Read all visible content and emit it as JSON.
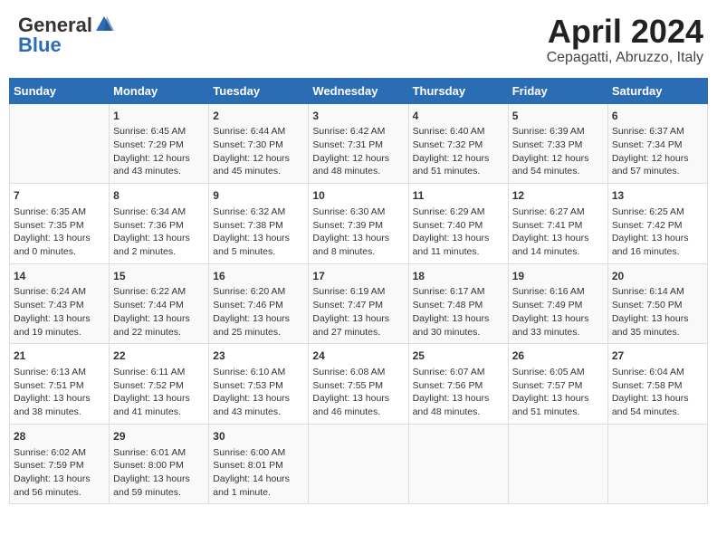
{
  "header": {
    "logo_general": "General",
    "logo_blue": "Blue",
    "title": "April 2024",
    "subtitle": "Cepagatti, Abruzzo, Italy"
  },
  "days_of_week": [
    "Sunday",
    "Monday",
    "Tuesday",
    "Wednesday",
    "Thursday",
    "Friday",
    "Saturday"
  ],
  "weeks": [
    [
      {
        "day": "",
        "content": ""
      },
      {
        "day": "1",
        "content": "Sunrise: 6:45 AM\nSunset: 7:29 PM\nDaylight: 12 hours\nand 43 minutes."
      },
      {
        "day": "2",
        "content": "Sunrise: 6:44 AM\nSunset: 7:30 PM\nDaylight: 12 hours\nand 45 minutes."
      },
      {
        "day": "3",
        "content": "Sunrise: 6:42 AM\nSunset: 7:31 PM\nDaylight: 12 hours\nand 48 minutes."
      },
      {
        "day": "4",
        "content": "Sunrise: 6:40 AM\nSunset: 7:32 PM\nDaylight: 12 hours\nand 51 minutes."
      },
      {
        "day": "5",
        "content": "Sunrise: 6:39 AM\nSunset: 7:33 PM\nDaylight: 12 hours\nand 54 minutes."
      },
      {
        "day": "6",
        "content": "Sunrise: 6:37 AM\nSunset: 7:34 PM\nDaylight: 12 hours\nand 57 minutes."
      }
    ],
    [
      {
        "day": "7",
        "content": "Sunrise: 6:35 AM\nSunset: 7:35 PM\nDaylight: 13 hours\nand 0 minutes."
      },
      {
        "day": "8",
        "content": "Sunrise: 6:34 AM\nSunset: 7:36 PM\nDaylight: 13 hours\nand 2 minutes."
      },
      {
        "day": "9",
        "content": "Sunrise: 6:32 AM\nSunset: 7:38 PM\nDaylight: 13 hours\nand 5 minutes."
      },
      {
        "day": "10",
        "content": "Sunrise: 6:30 AM\nSunset: 7:39 PM\nDaylight: 13 hours\nand 8 minutes."
      },
      {
        "day": "11",
        "content": "Sunrise: 6:29 AM\nSunset: 7:40 PM\nDaylight: 13 hours\nand 11 minutes."
      },
      {
        "day": "12",
        "content": "Sunrise: 6:27 AM\nSunset: 7:41 PM\nDaylight: 13 hours\nand 14 minutes."
      },
      {
        "day": "13",
        "content": "Sunrise: 6:25 AM\nSunset: 7:42 PM\nDaylight: 13 hours\nand 16 minutes."
      }
    ],
    [
      {
        "day": "14",
        "content": "Sunrise: 6:24 AM\nSunset: 7:43 PM\nDaylight: 13 hours\nand 19 minutes."
      },
      {
        "day": "15",
        "content": "Sunrise: 6:22 AM\nSunset: 7:44 PM\nDaylight: 13 hours\nand 22 minutes."
      },
      {
        "day": "16",
        "content": "Sunrise: 6:20 AM\nSunset: 7:46 PM\nDaylight: 13 hours\nand 25 minutes."
      },
      {
        "day": "17",
        "content": "Sunrise: 6:19 AM\nSunset: 7:47 PM\nDaylight: 13 hours\nand 27 minutes."
      },
      {
        "day": "18",
        "content": "Sunrise: 6:17 AM\nSunset: 7:48 PM\nDaylight: 13 hours\nand 30 minutes."
      },
      {
        "day": "19",
        "content": "Sunrise: 6:16 AM\nSunset: 7:49 PM\nDaylight: 13 hours\nand 33 minutes."
      },
      {
        "day": "20",
        "content": "Sunrise: 6:14 AM\nSunset: 7:50 PM\nDaylight: 13 hours\nand 35 minutes."
      }
    ],
    [
      {
        "day": "21",
        "content": "Sunrise: 6:13 AM\nSunset: 7:51 PM\nDaylight: 13 hours\nand 38 minutes."
      },
      {
        "day": "22",
        "content": "Sunrise: 6:11 AM\nSunset: 7:52 PM\nDaylight: 13 hours\nand 41 minutes."
      },
      {
        "day": "23",
        "content": "Sunrise: 6:10 AM\nSunset: 7:53 PM\nDaylight: 13 hours\nand 43 minutes."
      },
      {
        "day": "24",
        "content": "Sunrise: 6:08 AM\nSunset: 7:55 PM\nDaylight: 13 hours\nand 46 minutes."
      },
      {
        "day": "25",
        "content": "Sunrise: 6:07 AM\nSunset: 7:56 PM\nDaylight: 13 hours\nand 48 minutes."
      },
      {
        "day": "26",
        "content": "Sunrise: 6:05 AM\nSunset: 7:57 PM\nDaylight: 13 hours\nand 51 minutes."
      },
      {
        "day": "27",
        "content": "Sunrise: 6:04 AM\nSunset: 7:58 PM\nDaylight: 13 hours\nand 54 minutes."
      }
    ],
    [
      {
        "day": "28",
        "content": "Sunrise: 6:02 AM\nSunset: 7:59 PM\nDaylight: 13 hours\nand 56 minutes."
      },
      {
        "day": "29",
        "content": "Sunrise: 6:01 AM\nSunset: 8:00 PM\nDaylight: 13 hours\nand 59 minutes."
      },
      {
        "day": "30",
        "content": "Sunrise: 6:00 AM\nSunset: 8:01 PM\nDaylight: 14 hours\nand 1 minute."
      },
      {
        "day": "",
        "content": ""
      },
      {
        "day": "",
        "content": ""
      },
      {
        "day": "",
        "content": ""
      },
      {
        "day": "",
        "content": ""
      }
    ]
  ]
}
